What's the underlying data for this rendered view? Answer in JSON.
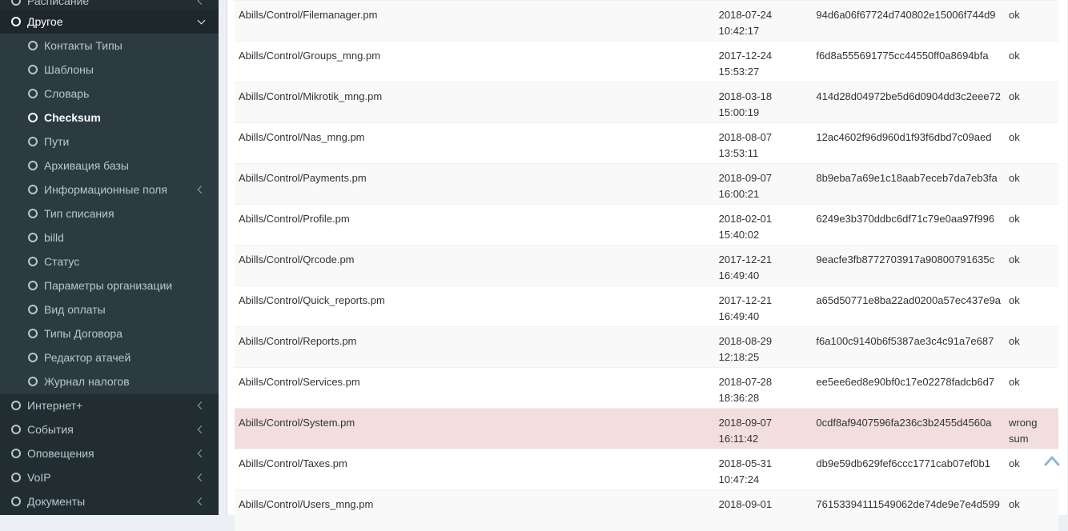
{
  "sidebar": {
    "partial_item": "Расписание",
    "section": {
      "label": "Другое"
    },
    "sub_items": [
      {
        "label": "Контакты Типы"
      },
      {
        "label": "Шаблоны"
      },
      {
        "label": "Словарь"
      },
      {
        "label": "Checksum"
      },
      {
        "label": "Пути"
      },
      {
        "label": "Архивация базы"
      },
      {
        "label": "Информационные поля"
      },
      {
        "label": "Тип списания"
      },
      {
        "label": "billd"
      },
      {
        "label": "Статус"
      },
      {
        "label": "Параметры организации"
      },
      {
        "label": "Вид оплаты"
      },
      {
        "label": "Типы Договора"
      },
      {
        "label": "Редактор атачей"
      },
      {
        "label": "Журнал налогов"
      }
    ],
    "bottom_items": [
      {
        "label": "Интернет+"
      },
      {
        "label": "События"
      },
      {
        "label": "Оповещения"
      },
      {
        "label": "VoIP"
      },
      {
        "label": "Документы"
      }
    ]
  },
  "table": {
    "rows": [
      {
        "path": "Abills/Control/Filemanager.pm",
        "date": "2018-07-24",
        "time": "10:42:17",
        "checksum": "94d6a06f67724d740802e15006f744d9",
        "status": "ok"
      },
      {
        "path": "Abills/Control/Groups_mng.pm",
        "date": "2017-12-24",
        "time": "15:53:27",
        "checksum": "f6d8a555691775cc44550ff0a8694bfa",
        "status": "ok"
      },
      {
        "path": "Abills/Control/Mikrotik_mng.pm",
        "date": "2018-03-18",
        "time": "15:00:19",
        "checksum": "414d28d04972be5d6d0904dd3c2eee72",
        "status": "ok"
      },
      {
        "path": "Abills/Control/Nas_mng.pm",
        "date": "2018-08-07",
        "time": "13:53:11",
        "checksum": "12ac4602f96d960d1f93f6dbd7c09aed",
        "status": "ok"
      },
      {
        "path": "Abills/Control/Payments.pm",
        "date": "2018-09-07",
        "time": "16:00:21",
        "checksum": "8b9eba7a69e1c18aab7eceb7da7eb3fa",
        "status": "ok"
      },
      {
        "path": "Abills/Control/Profile.pm",
        "date": "2018-02-01",
        "time": "15:40:02",
        "checksum": "6249e3b370ddbc6df71c79e0aa97f996",
        "status": "ok"
      },
      {
        "path": "Abills/Control/Qrcode.pm",
        "date": "2017-12-21",
        "time": "16:49:40",
        "checksum": "9eacfe3fb8772703917a90800791635c",
        "status": "ok"
      },
      {
        "path": "Abills/Control/Quick_reports.pm",
        "date": "2017-12-21",
        "time": "16:49:40",
        "checksum": "a65d50771e8ba22ad0200a57ec437e9a",
        "status": "ok"
      },
      {
        "path": "Abills/Control/Reports.pm",
        "date": "2018-08-29",
        "time": "12:18:25",
        "checksum": "f6a100c9140b6f5387ae3c4c91a7e687",
        "status": "ok"
      },
      {
        "path": "Abills/Control/Services.pm",
        "date": "2018-07-28",
        "time": "18:36:28",
        "checksum": "ee5ee6ed8e90bf0c17e02278fadcb6d7",
        "status": "ok"
      },
      {
        "path": "Abills/Control/System.pm",
        "date": "2018-09-07",
        "time": "16:11:42",
        "checksum": "0cdf8af9407596fa236c3b2455d4560a",
        "status": "wrong sum",
        "highlight": true
      },
      {
        "path": "Abills/Control/Taxes.pm",
        "date": "2018-05-31",
        "time": "10:47:24",
        "checksum": "db9e59db629fef6ccc1771cab07ef0b1",
        "status": "ok"
      },
      {
        "path": "Abills/Control/Users_mng.pm",
        "date": "2018-09-01",
        "time": "",
        "checksum": "76153394111549062de74de9e7e4d599",
        "status": "ok"
      }
    ]
  },
  "colors": {
    "sidebar_bg": "#222d32",
    "sidebar_sub_bg": "#2c3b41",
    "sidebar_text": "#b8c7ce",
    "row_stripe": "#f9f9f9",
    "row_danger": "#f2dede",
    "scroll_up_arrow": "#8fb8d6"
  },
  "icons": {
    "menu_marker": "circle-outline-icon",
    "expand": "chevron-left-icon",
    "expanded": "chevron-down-icon",
    "scroll_top": "chevron-up-icon"
  }
}
